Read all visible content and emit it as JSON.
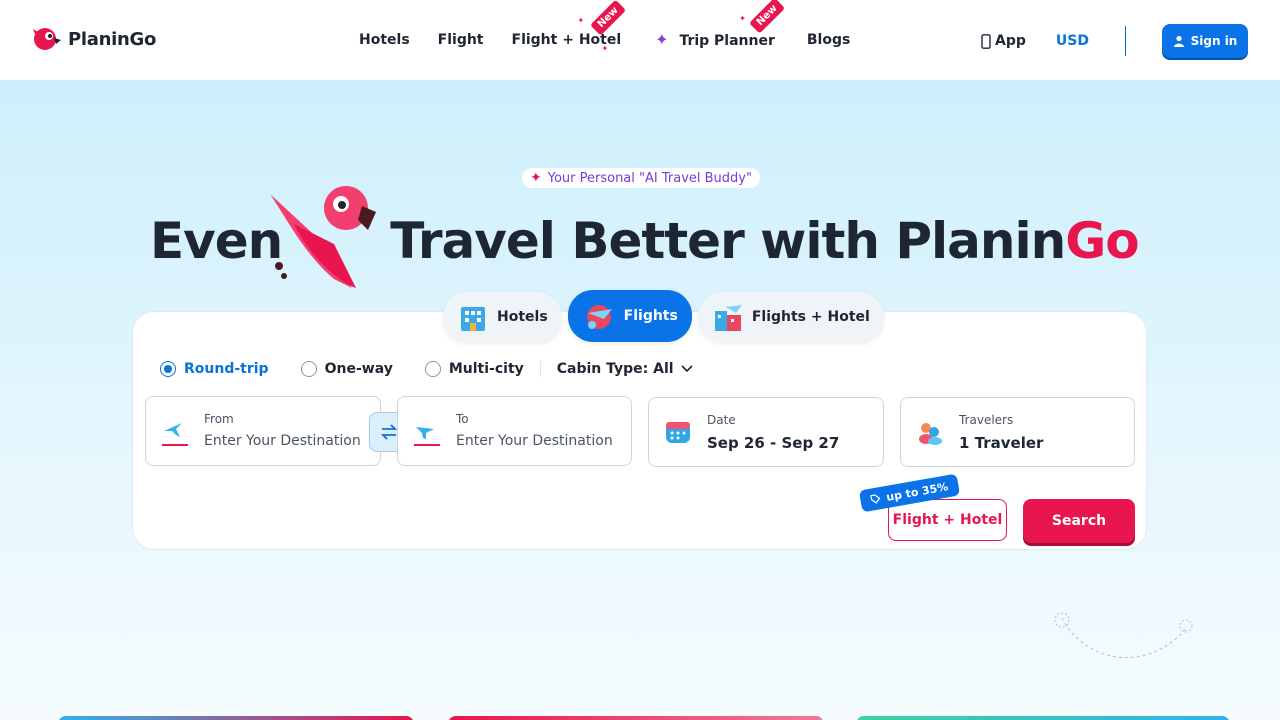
{
  "brand": {
    "name": "PlaninGo",
    "accent": "#e8154f",
    "primary": "#0a73e8"
  },
  "nav": {
    "items": [
      {
        "label": "Hotels",
        "badge": ""
      },
      {
        "label": "Flight",
        "badge": ""
      },
      {
        "label": "Flight + Hotel",
        "badge": "New"
      },
      {
        "label": "Trip Planner",
        "badge": "New"
      },
      {
        "label": "Blogs",
        "badge": ""
      }
    ]
  },
  "header_right": {
    "app_label": "App",
    "currency": "USD",
    "signin_label": "Sign in"
  },
  "hero": {
    "tagline": "Your Personal \"AI Travel Buddy\"",
    "headline_prefix": "Even",
    "headline_main": "Travel Better with Planin",
    "headline_accent": "Go"
  },
  "tabs": [
    {
      "label": "Hotels",
      "active": false
    },
    {
      "label": "Flights",
      "active": true
    },
    {
      "label": "Flights + Hotel",
      "active": false
    }
  ],
  "trip_types": [
    {
      "label": "Round-trip",
      "selected": true
    },
    {
      "label": "One-way",
      "selected": false
    },
    {
      "label": "Multi-city",
      "selected": false
    }
  ],
  "cabin": {
    "label": "Cabin Type: All"
  },
  "fields": {
    "from": {
      "label": "From",
      "placeholder": "Enter Your Destination"
    },
    "to": {
      "label": "To",
      "placeholder": "Enter Your Destination"
    },
    "date": {
      "label": "Date",
      "value": "Sep 26 - Sep 27"
    },
    "travelers": {
      "label": "Travelers",
      "value": "1 Traveler"
    }
  },
  "actions": {
    "promo": "up to 35%",
    "flight_hotel": "Flight + Hotel",
    "search": "Search"
  }
}
